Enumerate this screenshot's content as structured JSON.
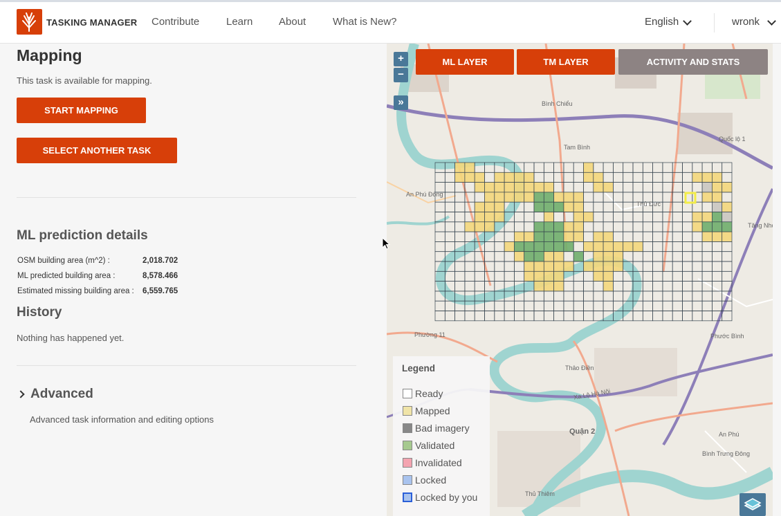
{
  "header": {
    "brand": "TASKING MANAGER",
    "nav": [
      "Contribute",
      "Learn",
      "About",
      "What is New?"
    ],
    "language": "English",
    "user": "wronk"
  },
  "panel": {
    "mapping_title": "Mapping",
    "availability": "This task is available for mapping.",
    "start_mapping": "START MAPPING",
    "select_another": "SELECT ANOTHER TASK",
    "ml_title": "ML prediction details",
    "ml_rows": [
      {
        "label": "OSM building area (m^2) :",
        "value": "2,018.702"
      },
      {
        "label": "ML predicted building area :",
        "value": "8,578.466"
      },
      {
        "label": "Estimated missing building area :",
        "value": "6,559.765"
      }
    ],
    "history_title": "History",
    "history_text": "Nothing has happened yet.",
    "advanced_title": "Advanced",
    "advanced_text": "Advanced task information and editing options"
  },
  "map": {
    "zoom_in": "+",
    "zoom_out": "−",
    "expand": "»",
    "tabs": [
      {
        "label": "ML LAYER",
        "color": "#d73f09"
      },
      {
        "label": "TM LAYER",
        "color": "#d73f09"
      },
      {
        "label": "ACTIVITY AND STATS",
        "color": "#8d8383"
      }
    ],
    "labels": [
      "Bình Chiểu",
      "Quốc lộ 1",
      "Tam Bình",
      "An Phú Đông",
      "Thủ Đức",
      "Phường 11",
      "Thảo Điền",
      "Quận 2",
      "Xa Lộ Hà Nội",
      "Bình Trưng Đông",
      "Phước Bình",
      "Tăng Nhơn Phú",
      "An Phú",
      "Thủ Thiêm"
    ],
    "legend": {
      "title": "Legend",
      "items": [
        {
          "label": "Ready",
          "color": "#ffffff"
        },
        {
          "label": "Mapped",
          "color": "#f0e4a8"
        },
        {
          "label": "Bad imagery",
          "color": "#888888"
        },
        {
          "label": "Validated",
          "color": "#a6c98f"
        },
        {
          "label": "Invalidated",
          "color": "#f4a4b0"
        },
        {
          "label": "Locked",
          "color": "#a9c3ee"
        },
        {
          "label": "Locked by you",
          "color": "#a9c3ee"
        }
      ]
    }
  },
  "colors": {
    "accent": "#d73f09",
    "secondary": "#8d8383",
    "map_control": "#4a7898",
    "mapped_cell": "#f3d77b",
    "validated_cell": "#6fae6b",
    "river": "#9fd4d0"
  }
}
